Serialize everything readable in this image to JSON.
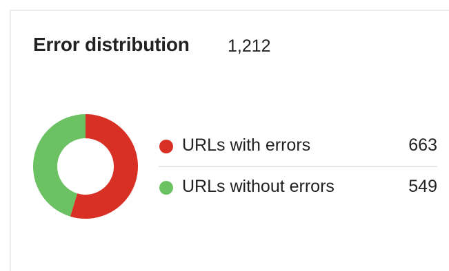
{
  "card": {
    "title": "Error distribution",
    "total": "1,212"
  },
  "chart_data": {
    "type": "pie",
    "subtype": "donut",
    "title": "Error distribution",
    "total": 1212,
    "legend_position": "right",
    "slices": [
      {
        "label": "URLs with errors",
        "value": 663,
        "color": "#d93025"
      },
      {
        "label": "URLs without errors",
        "value": 549,
        "color": "#6cc163"
      }
    ]
  },
  "legend": [
    {
      "label": "URLs with errors",
      "value": "663",
      "color": "#d93025"
    },
    {
      "label": "URLs without errors",
      "value": "549",
      "color": "#6cc163"
    }
  ]
}
